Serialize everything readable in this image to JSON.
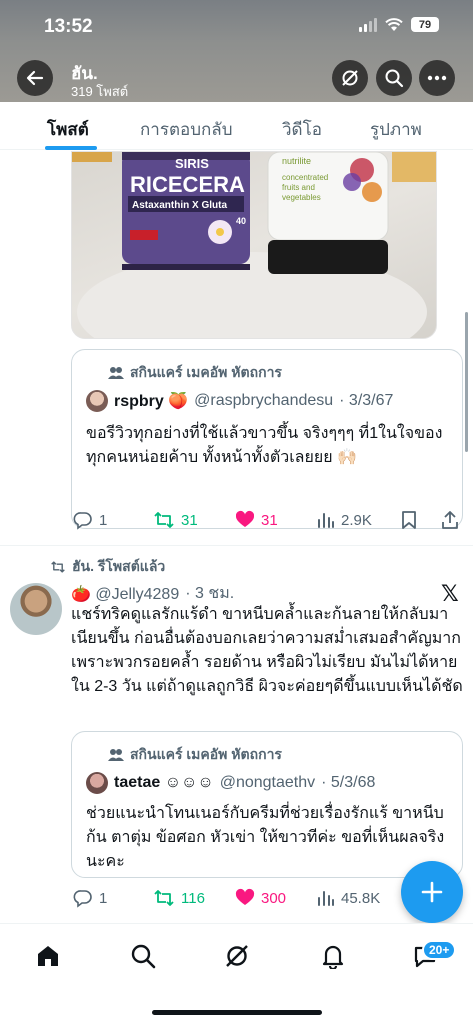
{
  "status_bar": {
    "time": "13:52",
    "battery": "79"
  },
  "profile": {
    "name": "ฮัน.",
    "post_count": "319 โพสต์"
  },
  "tabs": [
    {
      "label": "โพสต์"
    },
    {
      "label": "การตอบกลับ"
    },
    {
      "label": "วิดีโอ"
    },
    {
      "label": "รูปภาพ"
    }
  ],
  "media": {
    "product1": "SIRIS",
    "product1_name": "RICECERA",
    "product1_sub": "Astaxanthin X Gluta",
    "product2_brand": "nutrilite",
    "product2_text": "concentrated fruits and vegetables"
  },
  "quote1": {
    "category": "สกินแคร์ เมคอัพ หัตถการ",
    "name": "rspbry 🍑",
    "handle": "@raspbrychandesu",
    "date": "· 3/3/67",
    "text": "ขอรีวิวทุกอย่างที่ใช้แล้วขาวขึ้น จริงๆๆๆ ที่1ในใจของทุกคนหน่อยค้าบ ทั้งหน้าทั้งตัวเลยยย 🙌🏻"
  },
  "actions1": {
    "replies": "1",
    "reposts": "31",
    "likes": "31",
    "views": "2.9K"
  },
  "repost": {
    "label": "ฮัน. รีโพสต์แล้ว"
  },
  "post2": {
    "handle": "🍅 @Jelly4289",
    "time": "· 3 ชม.",
    "text": "แชร์ทริคดูแลรักแร้ดำ ขาหนีบคล้ำและก้นลายให้กลับมาเนียนขึ้น ก่อนอื่นต้องบอกเลยว่าความสม่ำเสมอสำคัญมาก เพราะพวกรอยคล้ำ รอยด้าน หรือผิวไม่เรียบ มันไม่ได้หายใน 2-3 วัน แต่ถ้าดูแลถูกวิธี ผิวจะค่อยๆดีขึ้นแบบเห็นได้ชัด"
  },
  "quote2": {
    "category": "สกินแคร์ เมคอัพ หัตถการ",
    "name": "taetae ☺☺☺",
    "handle": "@nongtaethv",
    "date": "· 5/3/68",
    "text": "ช่วยแนะนำโทนเนอร์กับครีมที่ช่วยเรื่องรักแร้ ขาหนีบ ก้น ตาตุ่ม ข้อศอก หัวเข่า ให้ขาวทีค่ะ ขอที่เห็นผลจริงนะคะ"
  },
  "actions2": {
    "replies": "1",
    "reposts": "116",
    "likes": "300",
    "views": "45.8K"
  },
  "tabbar": {
    "badge": "20+"
  },
  "colors": {
    "accent": "#1d9bf0",
    "repost": "#00ba7c",
    "like": "#f91880",
    "muted": "#536471"
  }
}
